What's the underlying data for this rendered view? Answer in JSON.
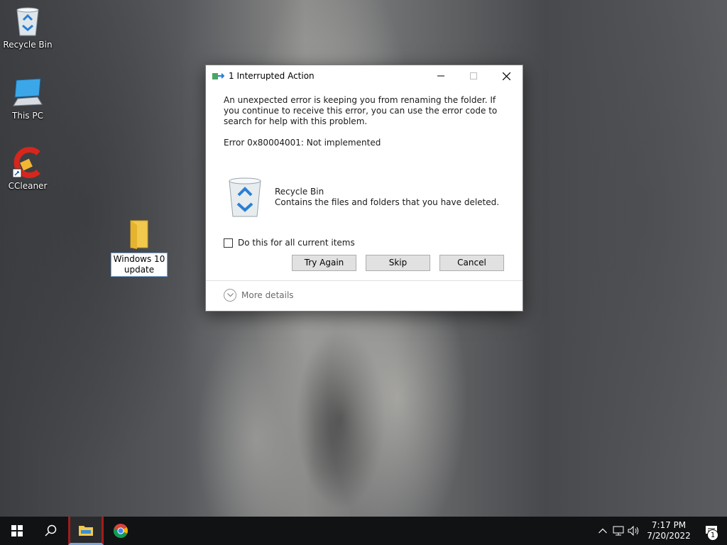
{
  "desktop": {
    "icons": [
      {
        "label": "Recycle Bin",
        "icon": "recycle-bin-icon"
      },
      {
        "label": "This PC",
        "icon": "computer-icon"
      },
      {
        "label": "CCleaner",
        "icon": "ccleaner-icon"
      },
      {
        "label": "Windows 10 update",
        "icon": "folder-icon"
      }
    ]
  },
  "dialog": {
    "title": "1 Interrupted Action",
    "message": "An unexpected error is keeping you from renaming the folder. If you continue to receive this error, you can use the error code to search for help with this problem.",
    "error": "Error 0x80004001: Not implemented",
    "item": {
      "name": "Recycle Bin",
      "description": "Contains the files and folders that you have deleted.",
      "icon": "recycle-bin-icon"
    },
    "checkbox_label": "Do this for all current items",
    "checkbox_checked": false,
    "buttons": {
      "try_again": "Try Again",
      "skip": "Skip",
      "cancel": "Cancel"
    },
    "more_details": "More details"
  },
  "taskbar": {
    "time": "7:17 PM",
    "date": "7/20/2022",
    "notification_count": "1"
  },
  "colors": {
    "taskbar_bg": "#111214",
    "button_bg": "#e1e1e1",
    "accent": "#7fa3d1"
  }
}
